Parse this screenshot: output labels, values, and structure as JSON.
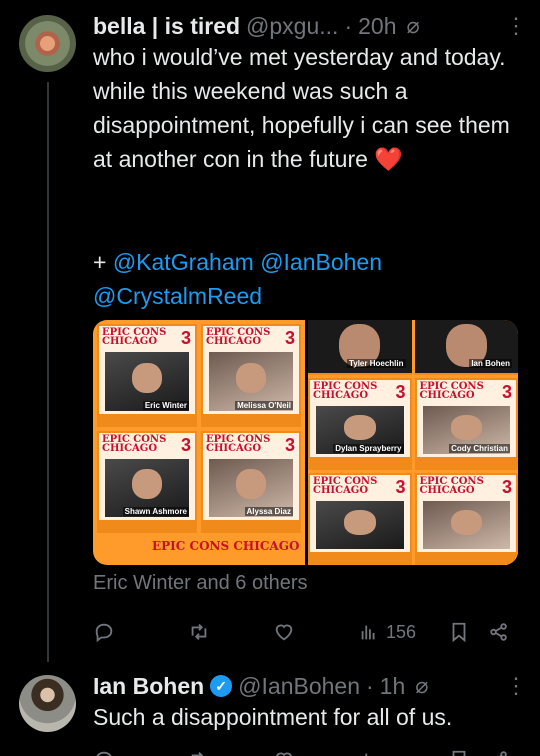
{
  "tweet1": {
    "name": "bella | is tired",
    "handle": "@pxgu...",
    "dot": "·",
    "time": "20h",
    "text": "who i would’ve met yesterday and today. while this weekend was such a disappointment, hopefully i can see them at another con in the future ",
    "emoji": "❤️",
    "plus": "+ ",
    "mentions": [
      "@KatGraham",
      "@IanBohen",
      "@CrystalmReed"
    ],
    "media": {
      "brand": "EPIC CONS CHICAGO",
      "brand_num": "3",
      "left_cards": [
        "Eric Winter",
        "Melissa O'Neil",
        "Shawn Ashmore",
        "Alyssa Diaz"
      ],
      "right_top": [
        "Tyler Hoechlin",
        "Ian Bohen"
      ],
      "right_cards": [
        "Dylan Sprayberry",
        "Cody Christian",
        "",
        ""
      ]
    },
    "liked_by": "Eric Winter and 6 others",
    "views": "156"
  },
  "tweet2": {
    "name": "Ian Bohen",
    "handle": "@IanBohen",
    "dot": "·",
    "time": "1h",
    "text": "Such a disappointment for all of us."
  },
  "icons": {
    "more": "more-icon",
    "slashed": "muted-icon",
    "verified": "verified-icon",
    "reply": "reply-icon",
    "retweet": "retweet-icon",
    "like": "like-icon",
    "views": "views-icon",
    "bookmark": "bookmark-icon",
    "share": "share-icon"
  },
  "colors": {
    "accent": "#1d9bf0",
    "secondary_text": "#71767b",
    "background": "#000000"
  }
}
